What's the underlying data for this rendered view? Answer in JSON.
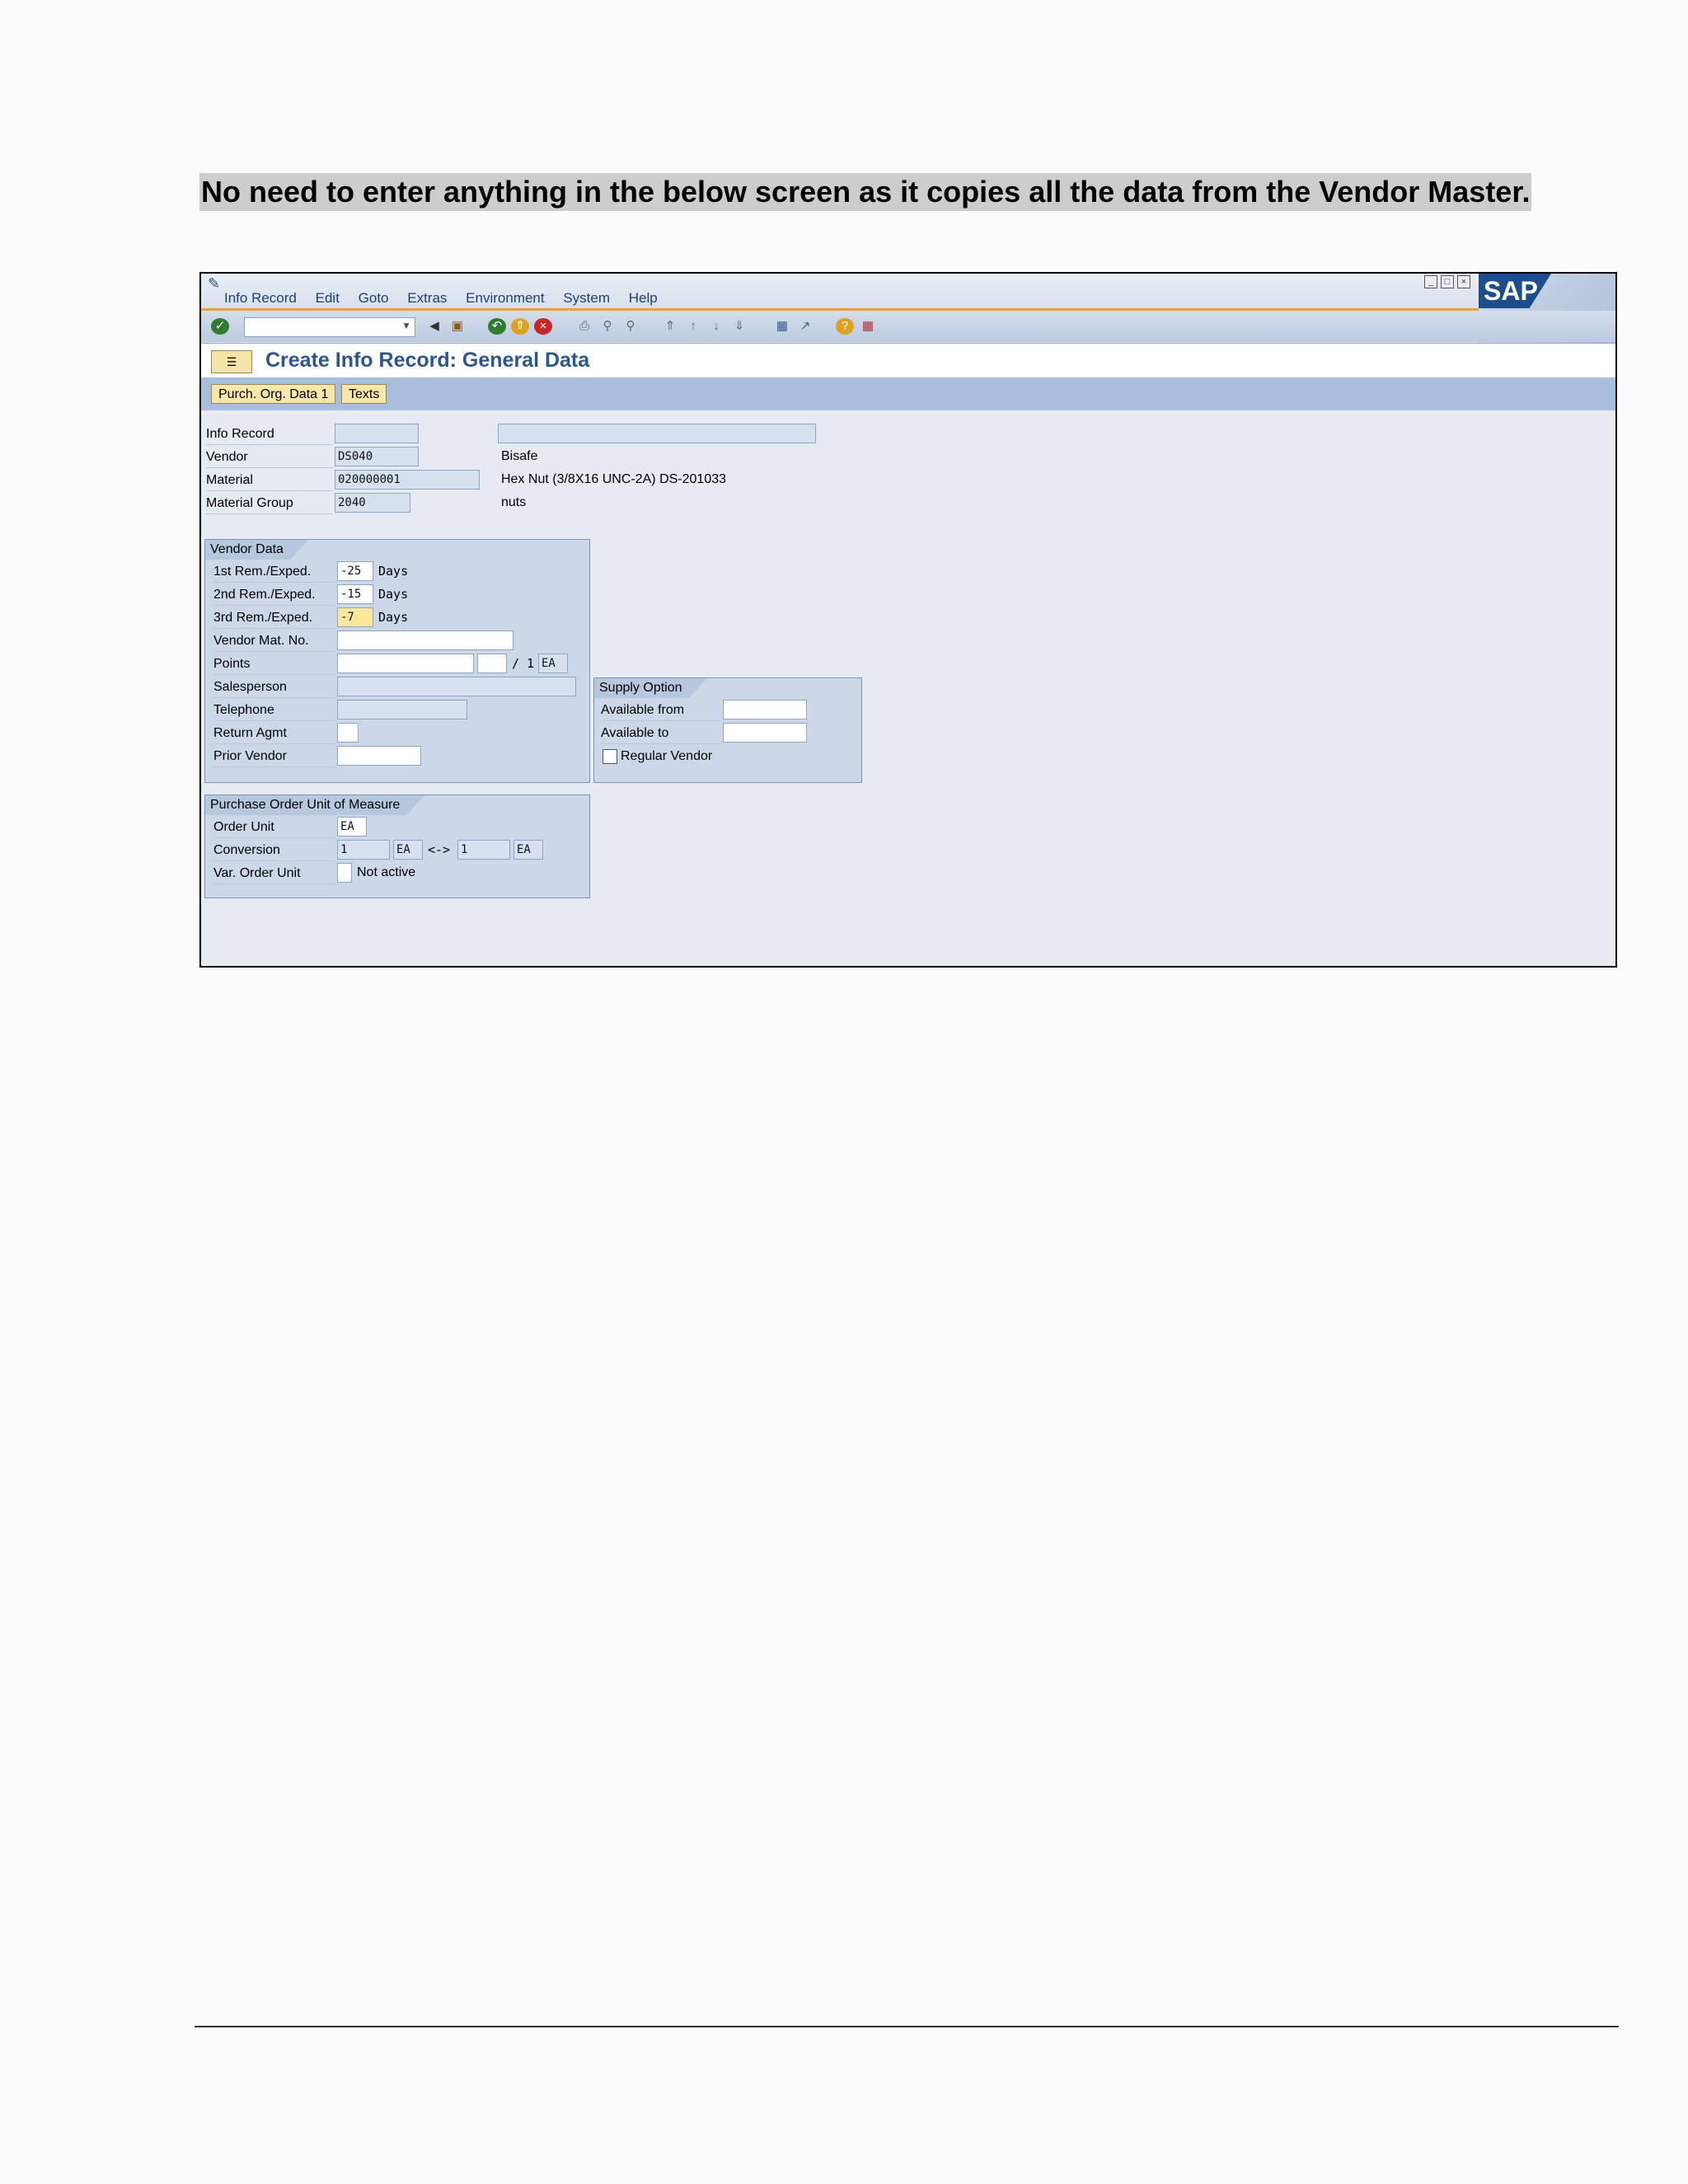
{
  "instruction": "No need to enter anything in the below screen as it copies all the data from the Vendor Master.",
  "menu": [
    "Info Record",
    "Edit",
    "Goto",
    "Extras",
    "Environment",
    "System",
    "Help"
  ],
  "logo_text": "SAP",
  "screen_title": "Create Info Record: General Data",
  "tabs": [
    "Purch. Org. Data 1",
    "Texts"
  ],
  "header_fields": {
    "info_record": {
      "label": "Info Record",
      "value": "",
      "desc": ""
    },
    "vendor": {
      "label": "Vendor",
      "value": "DS040",
      "desc": "Bisafe"
    },
    "material": {
      "label": "Material",
      "value": "020000001",
      "desc": "Hex Nut (3/8X16 UNC-2A) DS-201033"
    },
    "material_group": {
      "label": "Material Group",
      "value": "2040",
      "desc": "nuts"
    }
  },
  "vendor_data": {
    "title": "Vendor Data",
    "rem1": {
      "label": "1st Rem./Exped.",
      "value": "-25",
      "unit": "Days"
    },
    "rem2": {
      "label": "2nd Rem./Exped.",
      "value": "-15",
      "unit": "Days"
    },
    "rem3": {
      "label": "3rd Rem./Exped.",
      "value": "-7",
      "unit": "Days"
    },
    "vendor_mat_no": {
      "label": "Vendor Mat. No.",
      "value": ""
    },
    "points": {
      "label": "Points",
      "value": "",
      "per": "",
      "slash": "/",
      "qty": "1",
      "unit": "EA"
    },
    "salesperson": {
      "label": "Salesperson",
      "value": ""
    },
    "telephone": {
      "label": "Telephone",
      "value": ""
    },
    "return_agmt": {
      "label": "Return Agmt",
      "value": ""
    },
    "prior_vendor": {
      "label": "Prior Vendor",
      "value": ""
    }
  },
  "supply_option": {
    "title": "Supply Option",
    "available_from": {
      "label": "Available from",
      "value": ""
    },
    "available_to": {
      "label": "Available to",
      "value": ""
    },
    "regular_vendor": {
      "label": "Regular Vendor",
      "checked": false
    }
  },
  "po_unit": {
    "title": "Purchase Order Unit of Measure",
    "order_unit": {
      "label": "Order Unit",
      "value": "EA"
    },
    "conversion": {
      "label": "Conversion",
      "left_value": "1",
      "left_unit": "EA",
      "arrow": "<->",
      "right_value": "1",
      "right_unit": "EA"
    },
    "var_order_unit": {
      "label": "Var. Order Unit",
      "value": "",
      "status": "Not active"
    }
  }
}
